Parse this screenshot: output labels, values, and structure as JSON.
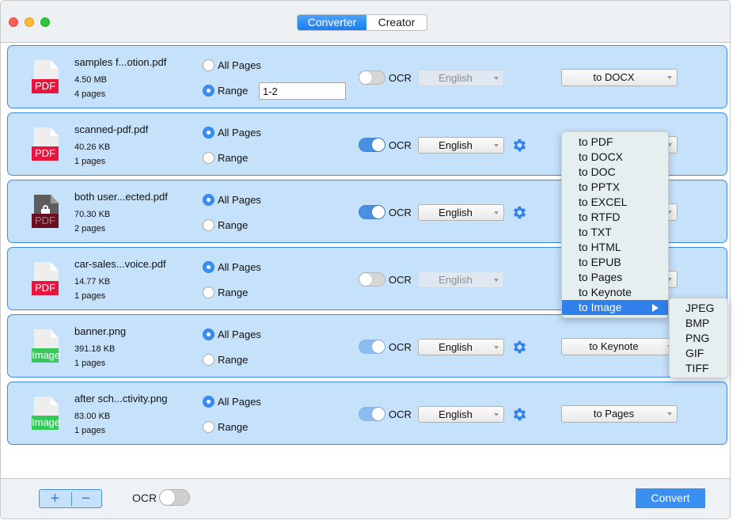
{
  "tabs": [
    {
      "label": "Converter",
      "active": true
    },
    {
      "label": "Creator",
      "active": false
    }
  ],
  "files": [
    {
      "name": "samples f...otion.pdf",
      "size": "4.50 MB",
      "pages": "4 pages",
      "type": "PDF",
      "locked": false,
      "all_pages_label": "All Pages",
      "range_label": "Range",
      "selected": "range",
      "range_value": "1-2",
      "ocr_label": "OCR",
      "ocr": "off",
      "language": "English",
      "language_enabled": false,
      "format": "to DOCX"
    },
    {
      "name": "scanned-pdf.pdf",
      "size": "40.26 KB",
      "pages": "1 pages",
      "type": "PDF",
      "locked": false,
      "all_pages_label": "All Pages",
      "range_label": "Range",
      "selected": "all",
      "range_value": "",
      "ocr_label": "OCR",
      "ocr": "on",
      "language": "English",
      "language_enabled": true,
      "format": ""
    },
    {
      "name": "both user...ected.pdf",
      "size": "70.30 KB",
      "pages": "2 pages",
      "type": "PDF",
      "locked": true,
      "all_pages_label": "All Pages",
      "range_label": "Range",
      "selected": "all",
      "range_value": "",
      "ocr_label": "OCR",
      "ocr": "on",
      "language": "English",
      "language_enabled": true,
      "format": ""
    },
    {
      "name": "car-sales...voice.pdf",
      "size": "14.77 KB",
      "pages": "1 pages",
      "type": "PDF",
      "locked": false,
      "all_pages_label": "All Pages",
      "range_label": "Range",
      "selected": "all",
      "range_value": "",
      "ocr_label": "OCR",
      "ocr": "off",
      "language": "English",
      "language_enabled": false,
      "format": ""
    },
    {
      "name": "banner.png",
      "size": "391.18 KB",
      "pages": "1 pages",
      "type": "Image",
      "locked": false,
      "all_pages_label": "All Pages",
      "range_label": "Range",
      "selected": "all",
      "range_value": "",
      "ocr_label": "OCR",
      "ocr": "on-fixed",
      "language": "English",
      "language_enabled": true,
      "format": "to Keynote"
    },
    {
      "name": "after sch...ctivity.png",
      "size": "83.00 KB",
      "pages": "1 pages",
      "type": "Image",
      "locked": false,
      "all_pages_label": "All Pages",
      "range_label": "Range",
      "selected": "all",
      "range_value": "",
      "ocr_label": "OCR",
      "ocr": "on-fixed",
      "language": "English",
      "language_enabled": true,
      "format": "to Pages"
    }
  ],
  "format_menu": {
    "items": [
      "to PDF",
      "to DOCX",
      "to DOC",
      "to PPTX",
      "to EXCEL",
      "to RTFD",
      "to TXT",
      "to HTML",
      "to EPUB",
      "to Pages",
      "to Keynote",
      "to Image"
    ],
    "highlighted": "to Image",
    "submenu": [
      "JPEG",
      "BMP",
      "PNG",
      "GIF",
      "TIFF"
    ]
  },
  "footer": {
    "add_label": "+",
    "remove_label": "−",
    "ocr_label": "OCR",
    "ocr": "off",
    "convert_label": "Convert"
  },
  "colors": {
    "accent": "#3a8ff0",
    "row_bg": "#c6e2fb",
    "pdf_badge": "#e8163e",
    "pdf_locked_badge": "#6b0d1e",
    "image_badge": "#35c95a"
  }
}
